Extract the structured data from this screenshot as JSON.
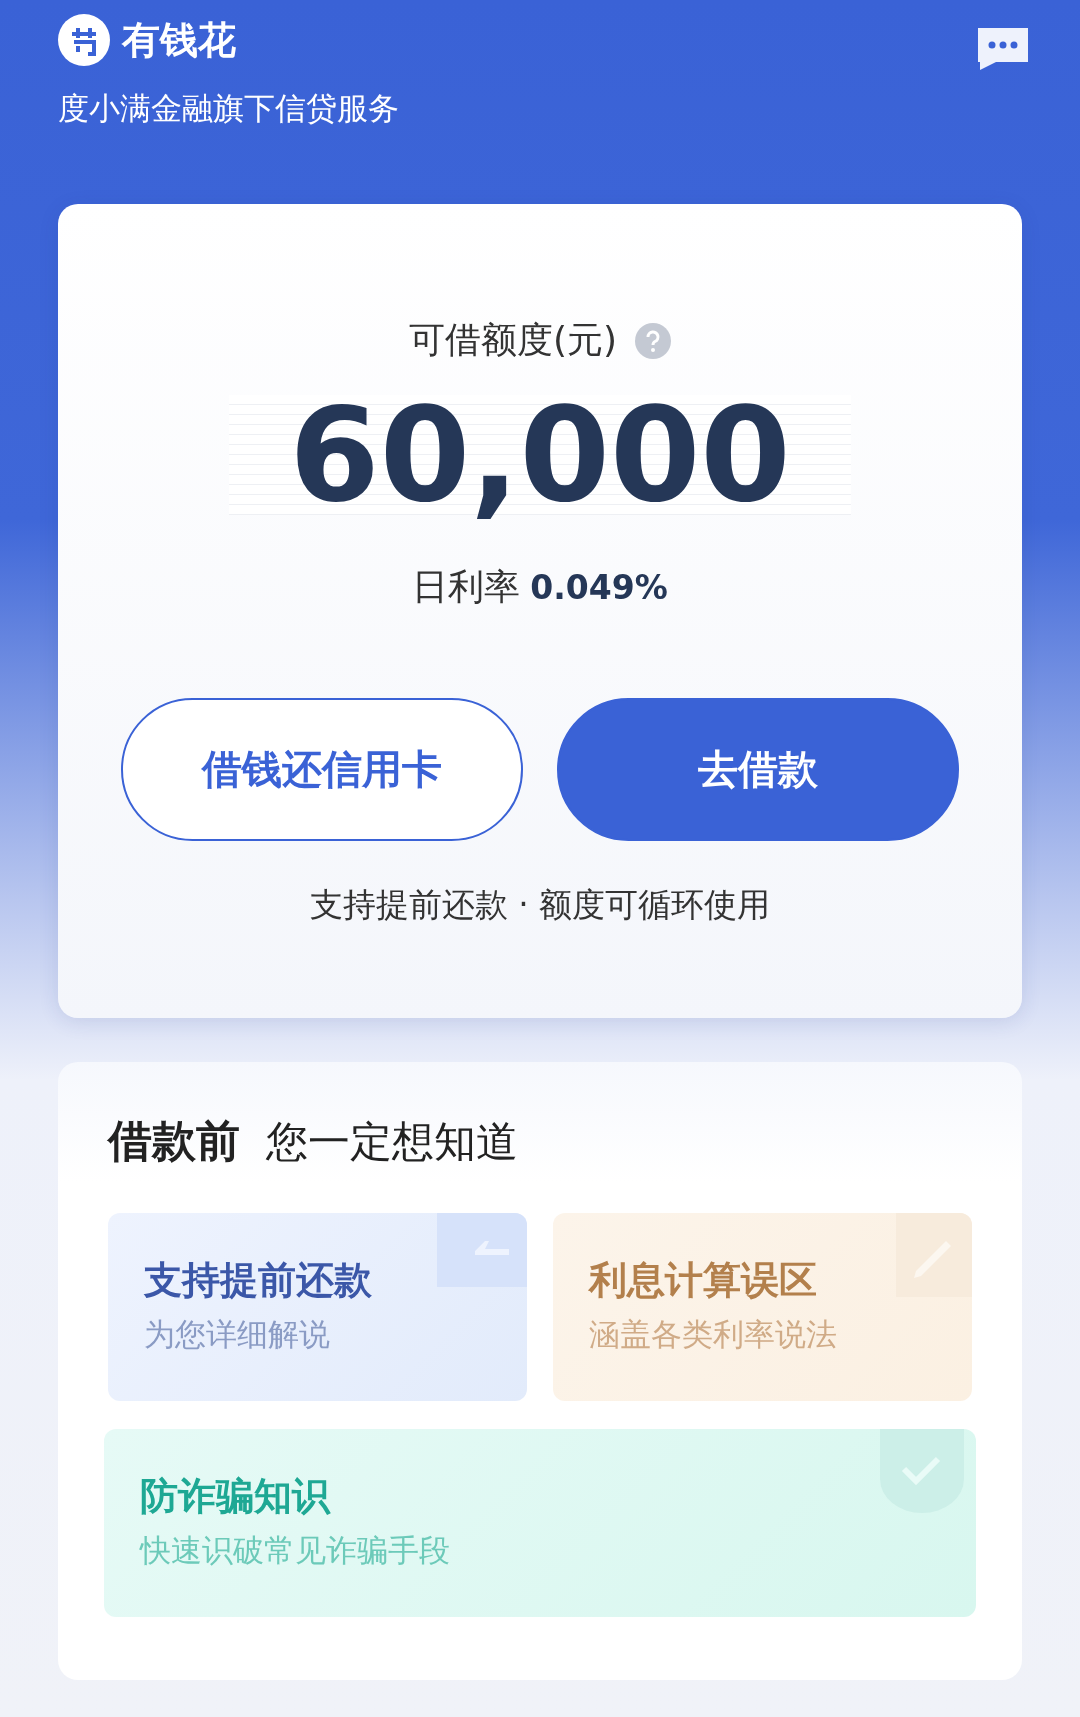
{
  "header": {
    "app_name": "有钱花",
    "subtitle": "度小满金融旗下信贷服务"
  },
  "credit_card": {
    "label": "可借额度(元)",
    "amount": "60,000",
    "rate_label": "日利率",
    "rate_value": "0.049%",
    "buttons": [
      {
        "label": "借钱还信用卡",
        "kind": "outline"
      },
      {
        "label": "去借款",
        "kind": "solid"
      }
    ],
    "note": "支持提前还款 · 额度可循环使用"
  },
  "faq": {
    "title": "借款前",
    "subtitle": "您一定想知道",
    "tiles": [
      {
        "title": "支持提前还款",
        "desc": "为您详细解说",
        "kind": "blue"
      },
      {
        "title": "利息计算误区",
        "desc": "涵盖各类利率说法",
        "kind": "orange"
      },
      {
        "title": "防诈骗知识",
        "desc": "快速识破常见诈骗手段",
        "kind": "green"
      }
    ]
  }
}
